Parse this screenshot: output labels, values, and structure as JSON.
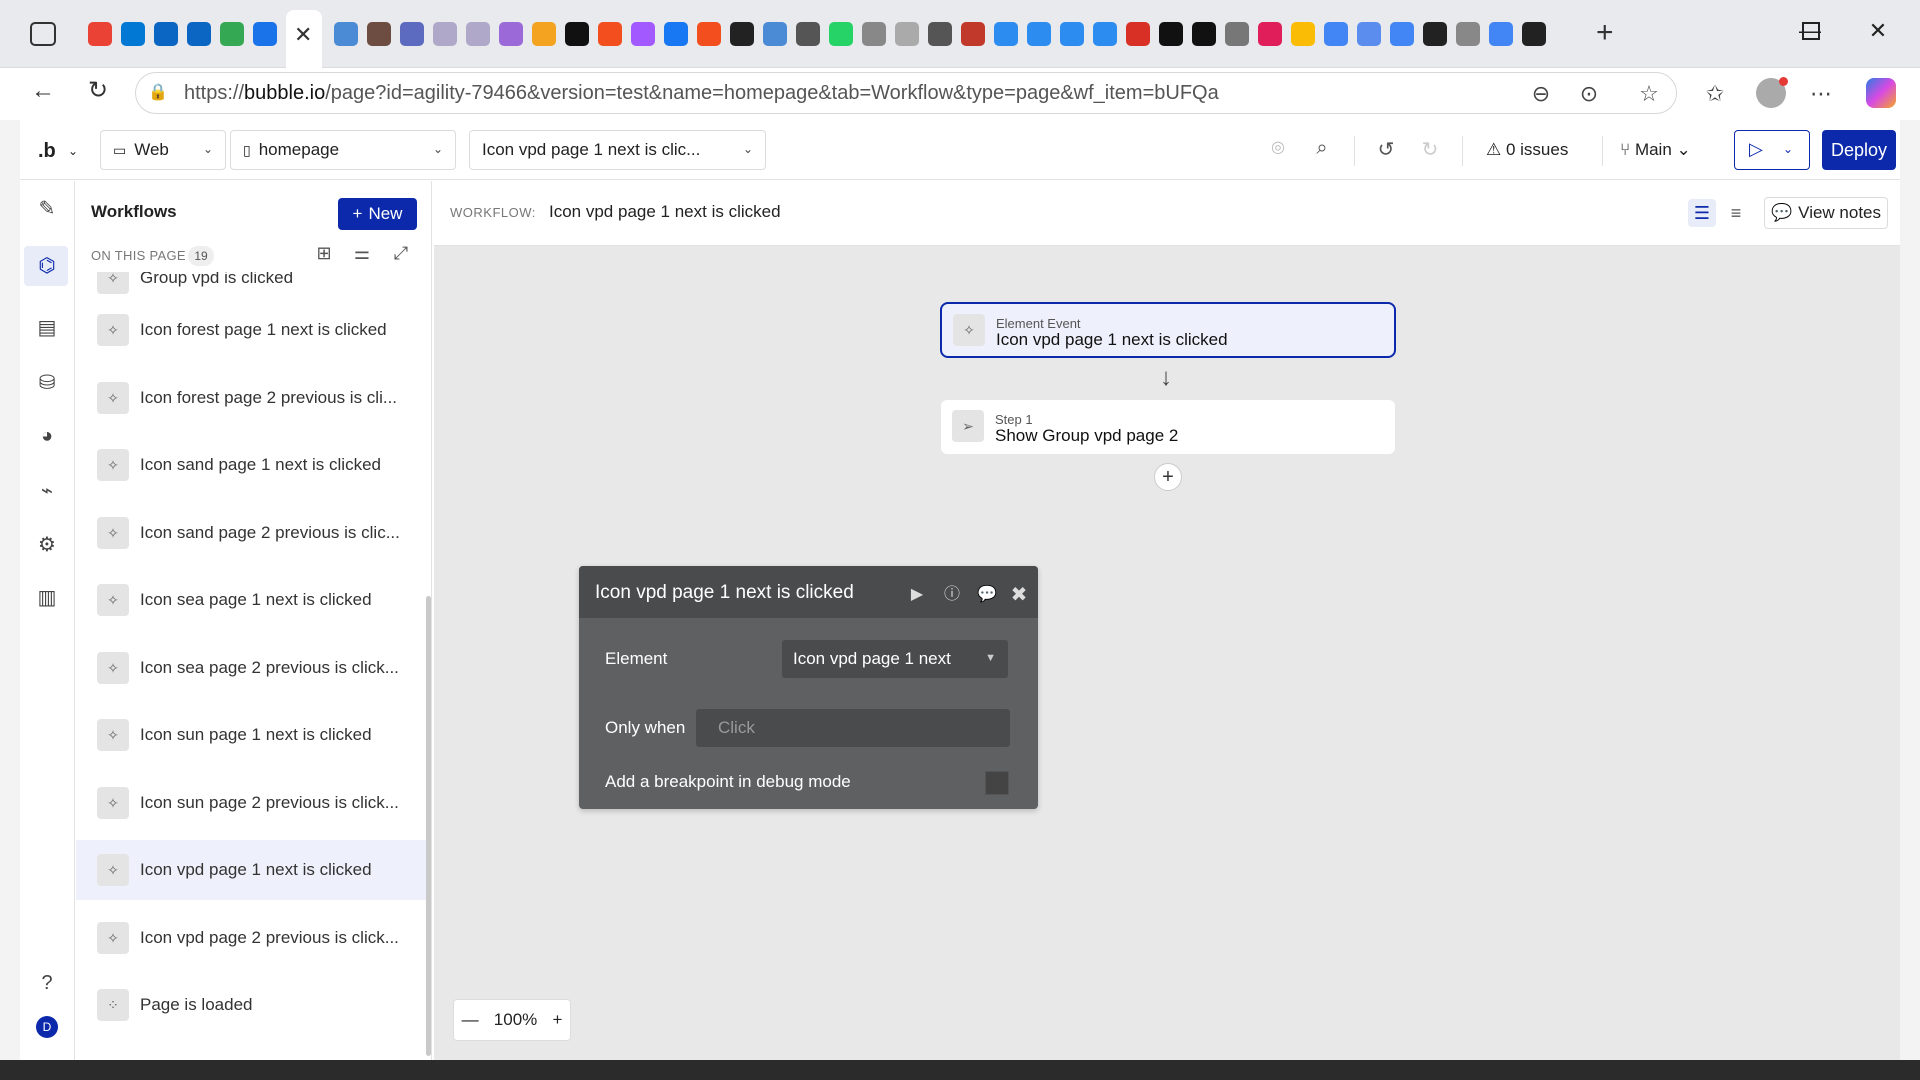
{
  "browser": {
    "url_prefix": "https://",
    "url_host": "bubble.io",
    "url_path": "/page?id=agility-79466&version=test&name=homepage&tab=Workflow&type=page&wf_item=bUFQa",
    "tab_icons": [
      "gmail-icon",
      "outlook-icon",
      "linkedin-icon",
      "linkedin-icon",
      "sheets-icon",
      "calendar-icon",
      "bubble-icon",
      "sailboat-icon",
      "coffee-icon",
      "v-icon",
      "doc-icon",
      "doc-icon",
      "s-icon",
      "chart-icon",
      "openai-icon",
      "figma-icon",
      "figma-icon",
      "facebook-icon",
      "figma-icon",
      "bubble-icon",
      "sailboat-icon",
      "arrow-icon",
      "whatsapp-icon",
      "info-icon",
      "o-icon",
      "window-icon",
      "star-icon",
      "image-icon",
      "image-icon",
      "image-icon",
      "image-icon",
      "pdf-icon",
      "wix-icon",
      "wix-icon",
      "globe-icon",
      "slack-icon",
      "grid-icon",
      "list-icon",
      "e-icon",
      "google-icon",
      "bubble-icon",
      "globe-icon",
      "google-icon",
      "bubble-icon"
    ],
    "colors": {
      "accent": "#0c29ab"
    }
  },
  "toolbar": {
    "logo": ".b",
    "platform": "Web",
    "page": "homepage",
    "workflow_select": "Icon vpd page 1 next is clic...",
    "issues": "0 issues",
    "branch": "Main",
    "deploy": "Deploy"
  },
  "sidebar": {
    "title": "Workflows",
    "new_label": "New",
    "on_this_page": "ON THIS PAGE",
    "count": "19",
    "items": [
      {
        "label": "Group vpd is clicked"
      },
      {
        "label": "Icon forest page 1 next is clicked"
      },
      {
        "label": "Icon forest page 2 previous is cli..."
      },
      {
        "label": "Icon sand page 1 next is clicked"
      },
      {
        "label": "Icon sand page 2 previous is clic..."
      },
      {
        "label": "Icon sea page 1 next is clicked"
      },
      {
        "label": "Icon sea page 2 previous is click..."
      },
      {
        "label": "Icon sun page 1 next is clicked"
      },
      {
        "label": "Icon sun page 2 previous is click..."
      },
      {
        "label": "Icon vpd page 1 next is clicked",
        "selected": true
      },
      {
        "label": "Icon vpd page 2 previous is click..."
      },
      {
        "label": "Page is loaded"
      }
    ],
    "rail_icons": [
      "pencil-icon",
      "workflow-icon",
      "layout-icon",
      "database-icon",
      "palette-icon",
      "plugin-icon",
      "settings-icon",
      "chart-icon",
      "help-icon",
      "avatar"
    ]
  },
  "workflow": {
    "label": "WORKFLOW:",
    "name": "Icon vpd page 1 next is clicked",
    "view_notes": "View notes",
    "event": {
      "type": "Element Event",
      "name": "Icon vpd page 1 next is clicked"
    },
    "step": {
      "type": "Step 1",
      "name": "Show Group vpd page 2"
    }
  },
  "editor": {
    "title": "Icon vpd page 1 next is clicked",
    "element_label": "Element",
    "element_value": "Icon vpd page 1 next",
    "only_when_label": "Only when",
    "only_when_placeholder": "Click",
    "breakpoint_label": "Add a breakpoint in debug mode"
  },
  "zoom": {
    "minus": "—",
    "value": "100%",
    "plus": "+"
  },
  "avatar_letter": "D"
}
